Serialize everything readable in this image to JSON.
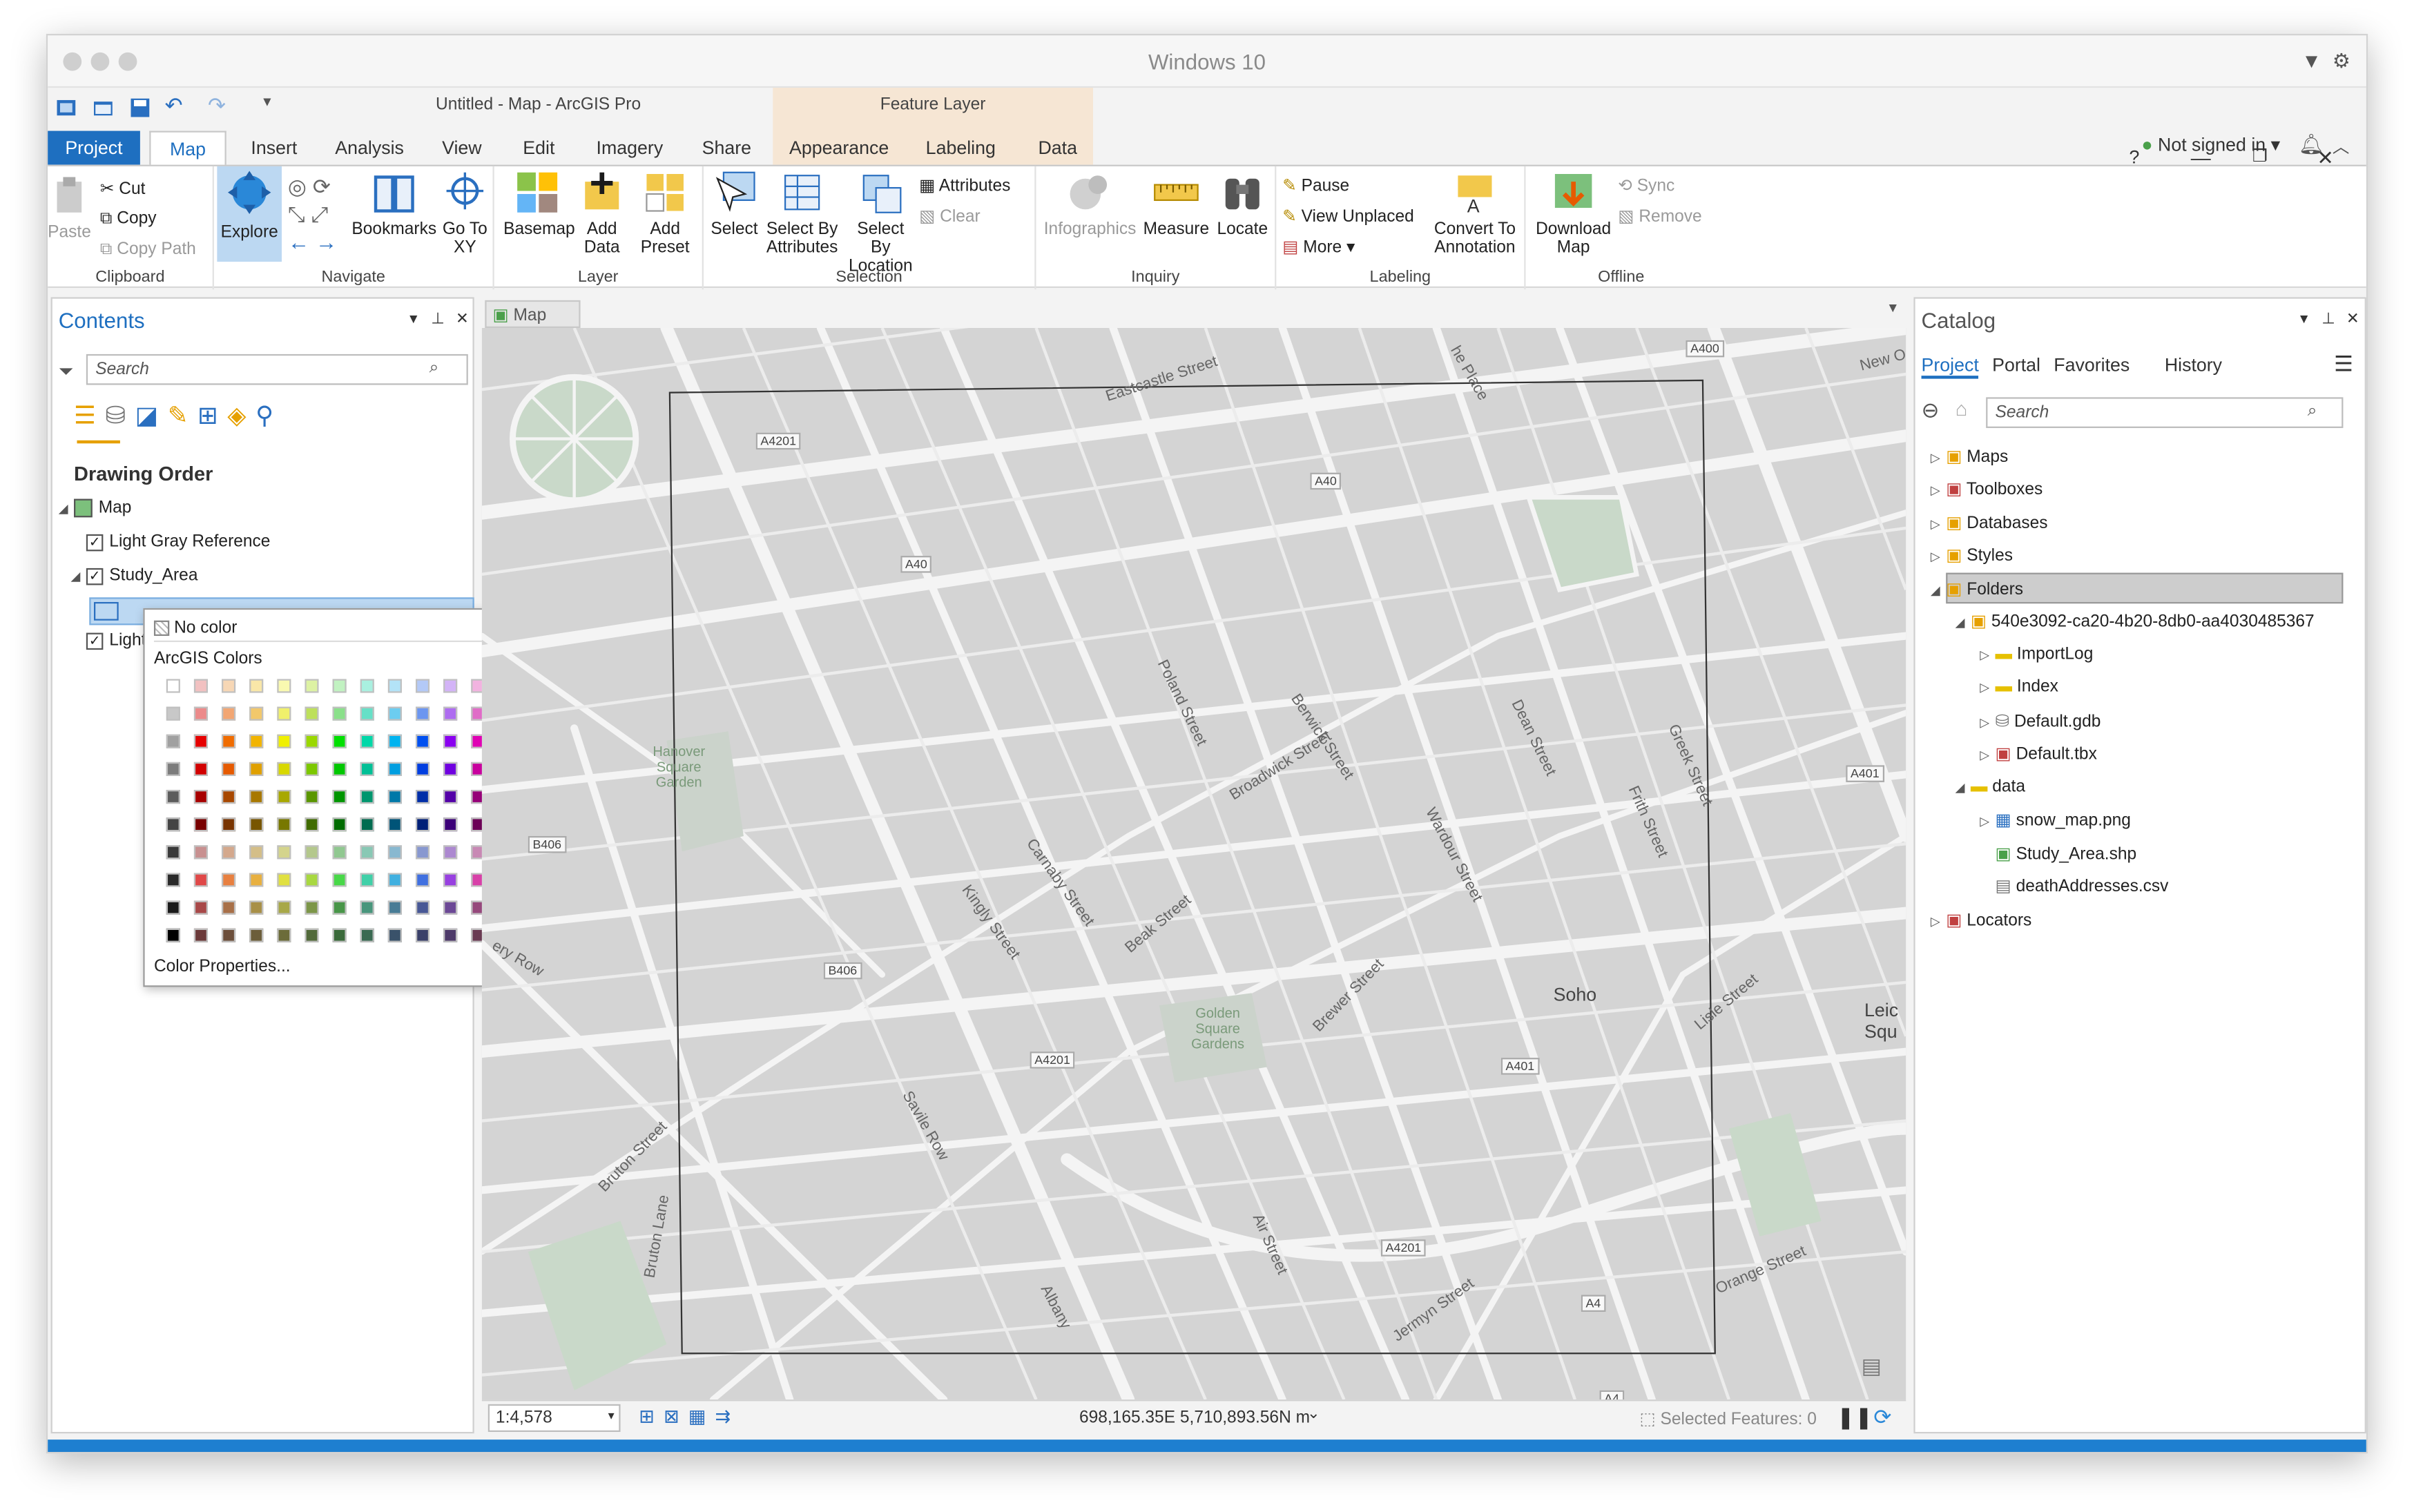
{
  "window": {
    "os_title": "Windows 10",
    "app_title": "Untitled - Map - ArcGIS Pro",
    "context_tab_group": "Feature Layer",
    "help": "?",
    "signin": "Not signed in"
  },
  "tabs": [
    "Project",
    "Map",
    "Insert",
    "Analysis",
    "View",
    "Edit",
    "Imagery",
    "Share",
    "Appearance",
    "Labeling",
    "Data"
  ],
  "ribbon": {
    "clipboard": {
      "label": "Clipboard",
      "paste": "Paste",
      "cut": "Cut",
      "copy": "Copy",
      "copy_path": "Copy Path"
    },
    "navigate": {
      "label": "Navigate",
      "explore": "Explore",
      "bookmarks": "Bookmarks",
      "goto": "Go To XY"
    },
    "layer": {
      "label": "Layer",
      "basemap": "Basemap",
      "add_data": "Add Data",
      "add_preset": "Add Preset"
    },
    "selection": {
      "label": "Selection",
      "select": "Select",
      "select_attr": "Select By Attributes",
      "select_loc": "Select By Location",
      "attributes": "Attributes",
      "clear": "Clear"
    },
    "inquiry": {
      "label": "Inquiry",
      "infographics": "Infographics",
      "measure": "Measure",
      "locate": "Locate"
    },
    "labeling": {
      "label": "Labeling",
      "pause": "Pause",
      "view_unplaced": "View Unplaced",
      "more": "More",
      "convert": "Convert To Annotation"
    },
    "offline": {
      "label": "Offline",
      "download": "Download Map",
      "sync": "Sync",
      "remove": "Remove"
    }
  },
  "contents": {
    "title": "Contents",
    "search_placeholder": "Search",
    "drawing_order": "Drawing Order",
    "map": "Map",
    "layer1": "Light Gray Reference",
    "layer2": "Study_Area",
    "layer3_partial": "Light"
  },
  "color_popup": {
    "no_color": "No color",
    "header": "ArcGIS Colors",
    "properties": "Color Properties...",
    "swatches": [
      [
        "#ffffff",
        "#f2c1c1",
        "#f7d7b5",
        "#f9e7a8",
        "#f9f9b0",
        "#ddf2a3",
        "#c1f2c1",
        "#a9f0e0",
        "#b3e3f7",
        "#b3c9f7",
        "#d3b3f7",
        "#f2b3e0"
      ],
      [
        "#c8c8c8",
        "#ec8a8a",
        "#f2a673",
        "#f2c86b",
        "#f0f06b",
        "#bde05b",
        "#8ae08a",
        "#66e0c7",
        "#6ccdf0",
        "#6c96f0",
        "#ae6cf0",
        "#e06cc7"
      ],
      [
        "#a0a0a0",
        "#e60000",
        "#f06c00",
        "#f2b400",
        "#f0f000",
        "#9ad800",
        "#00e000",
        "#00d8a8",
        "#00b4f0",
        "#0050f0",
        "#8a00f0",
        "#e000b4"
      ],
      [
        "#7c7c7c",
        "#d20000",
        "#e65a00",
        "#e0a000",
        "#d8d800",
        "#7cc800",
        "#00c800",
        "#00c096",
        "#009ee0",
        "#003ee0",
        "#7000e0",
        "#c8009e"
      ],
      [
        "#5c5c5c",
        "#a80000",
        "#a84800",
        "#a87800",
        "#a8a800",
        "#5a9600",
        "#009600",
        "#00966e",
        "#0078a8",
        "#002ea8",
        "#5400a8",
        "#960078"
      ],
      [
        "#444444",
        "#780000",
        "#783400",
        "#785600",
        "#787800",
        "#406c00",
        "#006c00",
        "#006c50",
        "#005478",
        "#002078",
        "#3c0078",
        "#6c0056"
      ],
      [
        "#3a3a3a",
        "#c89090",
        "#d4a88c",
        "#d4be88",
        "#d4d48c",
        "#b4c88c",
        "#90c890",
        "#88c8b4",
        "#88b8d0",
        "#8898d0",
        "#ac88d0",
        "#c888b4"
      ],
      [
        "#2a2a2a",
        "#e04848",
        "#e88040",
        "#e8b040",
        "#e0e040",
        "#a8d840",
        "#48d848",
        "#40d0a8",
        "#40b0e0",
        "#4070e0",
        "#9840e0",
        "#d840a8"
      ],
      [
        "#1a1a1a",
        "#a84848",
        "#a87048",
        "#a89048",
        "#a8a848",
        "#7c9648",
        "#489648",
        "#48967c",
        "#487c96",
        "#485896",
        "#6c4896",
        "#96487c"
      ],
      [
        "#000000",
        "#6c3a3a",
        "#6c4e3a",
        "#6c5e3a",
        "#6c6c3a",
        "#526a3a",
        "#3a6a3a",
        "#3a6a52",
        "#3a526a",
        "#3a406a",
        "#4e3a6a",
        "#6a3a52"
      ]
    ]
  },
  "map": {
    "tab": "Map",
    "scale": "1:4,578",
    "coords": "698,165.35E 5,710,893.56N m",
    "selected": "Selected Features: 0",
    "labels": {
      "eastcastle": "Eastcastle Street",
      "a4201_top": "A4201",
      "a40_top": "A40",
      "a40_left": "A40",
      "a400": "A400",
      "new_ox": "New O",
      "poland": "Poland Street",
      "berwick": "Berwick Street",
      "dean": "Dean Street",
      "greek": "Greek Street",
      "frith": "Frith Street",
      "hanover": "Hanover Square Garden",
      "broadwick": "Broadwick Street",
      "wardour": "Wardour Street",
      "carnaby": "Carnaby Street",
      "kingly": "Kingly Street",
      "b406_left": "B406",
      "b406_mid": "B406",
      "beak": "Beak Street",
      "a401_right": "A401",
      "golden": "Golden Square Gardens",
      "brewer": "Brewer Street",
      "soho": "Soho",
      "leic": "Leic Squ",
      "lisle": "Lisle Street",
      "a4201_mid": "A4201",
      "a401_mid": "A401",
      "savile": "Savile Row",
      "bruton_st": "Bruton Street",
      "bruton_ln": "Bruton Lane",
      "albany": "Albany",
      "air": "Air Street",
      "a4201_bot": "A4201",
      "a4": "A4",
      "a4_b": "A4",
      "jermyn": "Jermyn Street",
      "orange": "Orange Street",
      "ery": "ery Row",
      "che_place": "he Place"
    }
  },
  "catalog": {
    "title": "Catalog",
    "tabs": [
      "Project",
      "Portal",
      "Favorites",
      "History"
    ],
    "search_placeholder": "Search",
    "items": [
      "Maps",
      "Toolboxes",
      "Databases",
      "Styles",
      "Folders"
    ],
    "folder_id": "540e3092-ca20-4b20-8db0-aa4030485367",
    "folder_items": [
      "ImportLog",
      "Index",
      "Default.gdb",
      "Default.tbx"
    ],
    "data_folder": "data",
    "data_items": [
      "snow_map.png",
      "Study_Area.shp",
      "deathAddresses.csv"
    ],
    "locators": "Locators"
  }
}
